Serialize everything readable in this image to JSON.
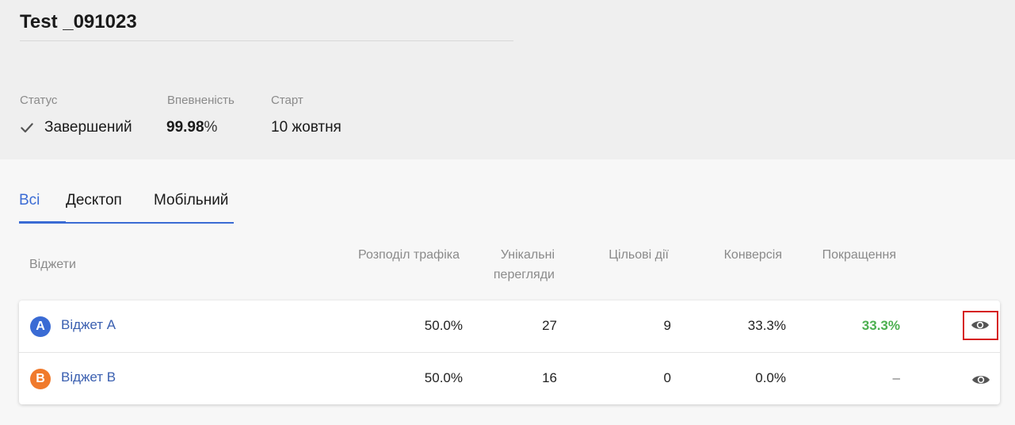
{
  "header": {
    "title": "Test _091023",
    "status_label": "Статус",
    "status_value": "Завершений",
    "confidence_label": "Впевненість",
    "confidence_number": "99.98",
    "confidence_percent": "%",
    "start_label": "Старт",
    "start_value": "10 жовтня"
  },
  "tabs": [
    {
      "label": "Всі",
      "active": true
    },
    {
      "label": "Десктоп",
      "active": false
    },
    {
      "label": "Мобільний",
      "active": false
    }
  ],
  "columns": {
    "widgets": "Віджети",
    "traffic": "Розподіл трафіка",
    "unique_views_line1": "Унікальні",
    "unique_views_line2": "перегляди",
    "goals": "Цільові дії",
    "conversion": "Конверсія",
    "improvement": "Покращення"
  },
  "rows": [
    {
      "badge": "A",
      "badge_color": "#3a6bd4",
      "name": "Віджет A",
      "traffic": "50.0%",
      "unique_views": "27",
      "goals": "9",
      "conversion": "33.3%",
      "improvement": "33.3%",
      "improvement_color": "#4caf50"
    },
    {
      "badge": "B",
      "badge_color": "#f07a2c",
      "name": "Віджет B",
      "traffic": "50.0%",
      "unique_views": "16",
      "goals": "0",
      "conversion": "0.0%",
      "improvement": "–",
      "improvement_color": "#777777"
    }
  ],
  "icons": {
    "status": "check-icon",
    "view": "eye-icon"
  },
  "colors": {
    "accent": "#3a6bd4",
    "positive": "#4caf50",
    "highlight_box": "#d61f1f"
  }
}
